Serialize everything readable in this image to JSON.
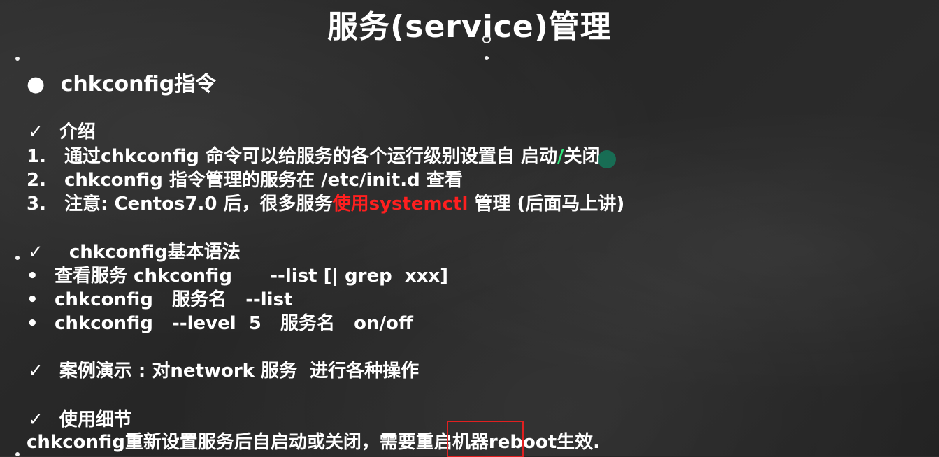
{
  "slide": {
    "title": "服务(service)管理",
    "bullet_main": "chkconfig指令",
    "check_mark": "✓",
    "bullet_dot": "●",
    "small_dot": "•",
    "intro": {
      "heading": "介绍",
      "items": [
        {
          "num": "1.",
          "text_a": "通过chkconfig 命令可以给服务的各个运行级别设置自 启动",
          "text_green": "/",
          "text_b": "关闭"
        },
        {
          "num": "2.",
          "text": "chkconfig 指令管理的服务在 /etc/init.d 查看"
        },
        {
          "num": "3.",
          "text_a": "注意: Centos7.0 后，很多服务",
          "text_red": "使用systemctl",
          "text_b": " 管理 (后面马上讲)"
        }
      ]
    },
    "syntax": {
      "heading": "chkconfig基本语法",
      "lines": [
        "查看服务 chkconfig      --list [| grep  xxx]",
        "chkconfig   服务名   --list",
        "chkconfig   --level  5   服务名   on/off"
      ]
    },
    "demo": {
      "heading": "案例演示 : 对network 服务  进行各种操作"
    },
    "detail": {
      "heading": "使用细节",
      "text_a": "chkconfig重新设置服务后自启动或关闭，需要",
      "text_boxed": "重启机器",
      "text_b": "reboot生效."
    }
  },
  "colors": {
    "accent_red": "#ff1f1f",
    "accent_green": "#2ee67a",
    "box_red": "#e02020"
  }
}
